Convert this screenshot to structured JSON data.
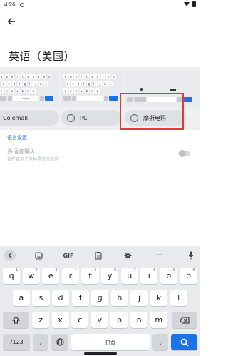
{
  "status_bar": {
    "time": "4:26"
  },
  "page": {
    "title": "英语（美国）"
  },
  "layouts": {
    "mini_keys_row1": [
      "q",
      "w",
      "e",
      "r",
      "t",
      "y",
      "u",
      "i",
      "o",
      "p"
    ],
    "mini_keys_row2": [
      "a",
      "s",
      "d",
      "f",
      "g",
      "h",
      "j",
      "k",
      "l"
    ],
    "mini_keys_row3": [
      "z",
      "x",
      "c",
      "v",
      "b",
      "n",
      "m"
    ],
    "mini_space_label": "English",
    "options": [
      {
        "label": "Colemak"
      },
      {
        "label": "PC"
      },
      {
        "label": "摩斯电码"
      }
    ]
  },
  "language_settings_label": "语言设置",
  "multilingual": {
    "title": "多语言输入",
    "subtitle": "仅在启用了多种语言时适用",
    "enabled": false
  },
  "keyboard": {
    "toolbar": {
      "gif_label": "GIF"
    },
    "row1": [
      {
        "k": "q",
        "n": "1"
      },
      {
        "k": "w",
        "n": "2"
      },
      {
        "k": "e",
        "n": "3"
      },
      {
        "k": "r",
        "n": "4"
      },
      {
        "k": "t",
        "n": "5"
      },
      {
        "k": "y",
        "n": "6"
      },
      {
        "k": "u",
        "n": "7"
      },
      {
        "k": "i",
        "n": "8"
      },
      {
        "k": "o",
        "n": "9"
      },
      {
        "k": "p",
        "n": "0"
      }
    ],
    "row2": [
      "a",
      "s",
      "d",
      "f",
      "g",
      "h",
      "j",
      "k",
      "l"
    ],
    "row3": [
      "z",
      "x",
      "c",
      "v",
      "b",
      "n",
      "m"
    ],
    "symbols_label": "?123",
    "comma_label": ",",
    "space_label": "拼音",
    "period_label": ".",
    "accent_color": "#1a73e8"
  }
}
